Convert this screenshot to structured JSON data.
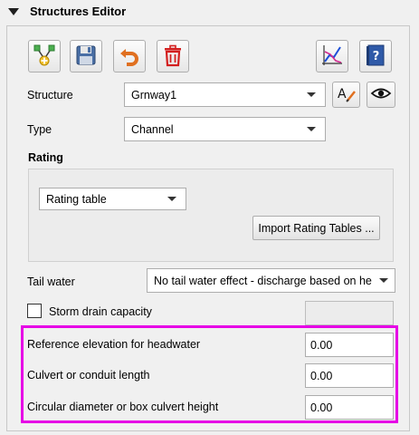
{
  "header": {
    "title": "Structures Editor"
  },
  "toolbar": {
    "buttons": [
      {
        "icon": "add-structure-icon"
      },
      {
        "icon": "save-icon"
      },
      {
        "icon": "undo-icon"
      },
      {
        "icon": "delete-icon"
      },
      {
        "icon": "schematize-icon"
      },
      {
        "icon": "help-icon"
      }
    ]
  },
  "structure": {
    "label": "Structure",
    "value": "Grnway1"
  },
  "type": {
    "label": "Type",
    "value": "Channel"
  },
  "rating": {
    "section_label": "Rating",
    "select_value": "Rating table",
    "import_button": "Import Rating Tables ..."
  },
  "tail_water": {
    "label": "Tail water",
    "value": "No tail water effect - discharge based on he"
  },
  "storm_drain": {
    "label": "Storm drain capacity",
    "checked": false,
    "value": ""
  },
  "fields": [
    {
      "label": "Reference elevation for headwater",
      "value": "0.00"
    },
    {
      "label": "Culvert or conduit length",
      "value": "0.00"
    },
    {
      "label": "Circular diameter or box culvert height",
      "value": "0.00"
    }
  ],
  "colors": {
    "highlight": "#e600e6",
    "delete_red": "#d32020",
    "undo_orange": "#e07020"
  }
}
